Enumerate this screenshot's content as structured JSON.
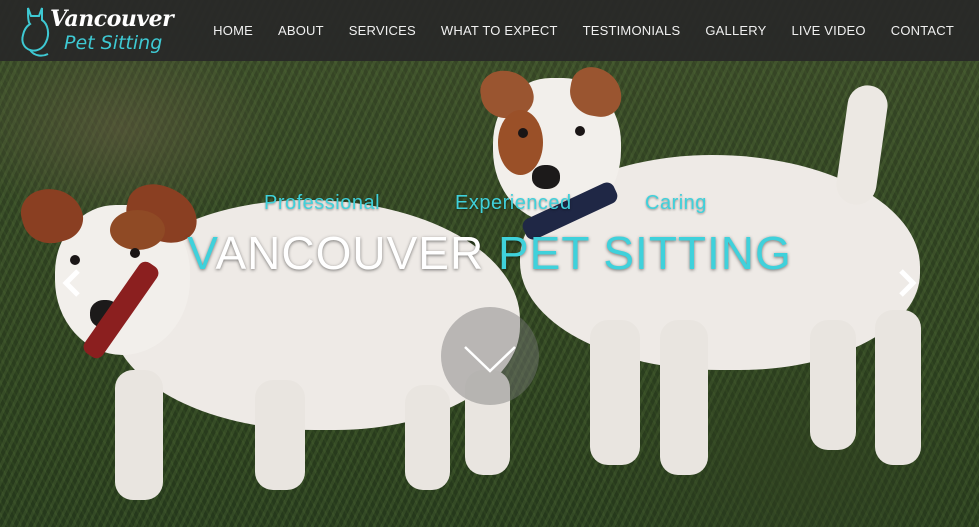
{
  "brand": {
    "line1": "Vancouver",
    "line2": "Pet Sitting",
    "accent_color": "#3ec9d3"
  },
  "nav": {
    "items": [
      {
        "label": "HOME"
      },
      {
        "label": "ABOUT"
      },
      {
        "label": "SERVICES"
      },
      {
        "label": "WHAT TO EXPECT"
      },
      {
        "label": "TESTIMONIALS"
      },
      {
        "label": "GALLERY"
      },
      {
        "label": "LIVE VIDEO"
      },
      {
        "label": "CONTACT"
      }
    ]
  },
  "hero": {
    "taglines": [
      "Professional",
      "Experienced",
      "Caring"
    ],
    "title_first_letter": "V",
    "title_white": "ANCOUVER ",
    "title_accent": "PET SITTING",
    "icons": {
      "prev": "chevron-left-icon",
      "next": "chevron-right-icon",
      "scroll": "chevron-down-icon"
    }
  }
}
